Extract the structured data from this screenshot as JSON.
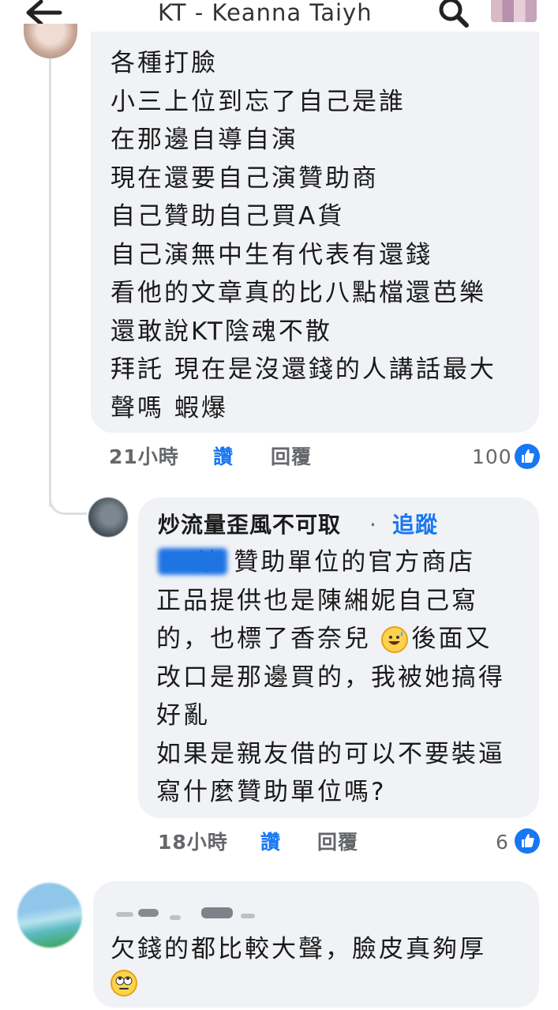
{
  "header": {
    "title": "KT - Keanna Taiyh",
    "back_icon": "arrow-left-icon",
    "search_icon": "search-icon"
  },
  "comments": [
    {
      "lines": [
        "各種打臉",
        "小三上位到忘了自己是誰",
        "在那邊自導自演",
        "現在還要自己演贊助商",
        "自己贊助自己買A貨",
        "自己演無中生有代表有還錢",
        "看他的文章真的比八點檔還芭樂",
        "還敢說KT陰魂不散",
        "拜託 現在是沒還錢的人講話最大",
        "聲嗎 蝦爆"
      ],
      "time": "21小時",
      "like_label": "讚",
      "reply_label": "回覆",
      "reaction_count": "100"
    },
    {
      "author": "炒流量歪風不可取",
      "follow_label": "追蹤",
      "separator": "·",
      "lines": [
        "    沙 贊助單位的官方商店",
        "正品提供也是陳緗妮自己寫",
        "的，也標了香奈兒    後面又",
        "改口是那邊買的，我被她搞得",
        "好亂",
        "如果是親友借的可以不要裝逼",
        "寫什麼贊助單位嗎?"
      ],
      "time": "18小時",
      "like_label": "讚",
      "reply_label": "回覆",
      "reaction_count": "6"
    },
    {
      "lines": [
        "欠錢的都比較大聲，臉皮真夠厚"
      ]
    }
  ],
  "colors": {
    "accent": "#1877f2",
    "bubble": "#f0f2f5",
    "meta": "#65676b",
    "thread_line": "#dcdfe3"
  }
}
